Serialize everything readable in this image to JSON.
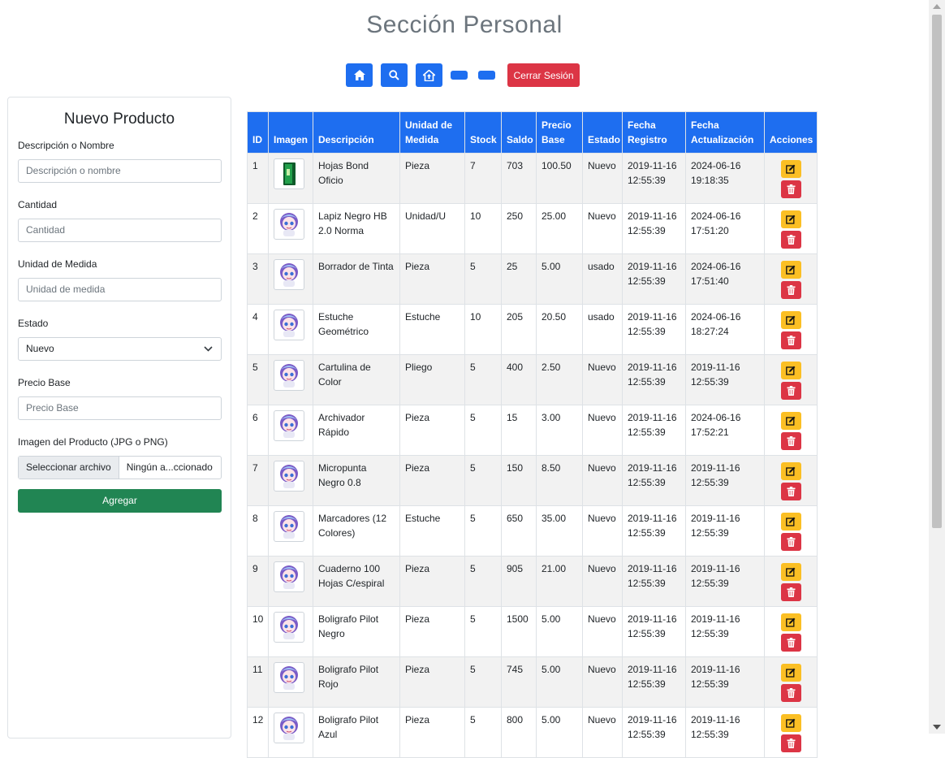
{
  "page": {
    "title": "Sección Personal"
  },
  "toolbar": {
    "home_icon": "home-icon",
    "search_icon": "search-icon",
    "house_up_icon": "house-up-icon",
    "logout_label": "Cerrar Sesión"
  },
  "form": {
    "title": "Nuevo Producto",
    "desc_label": "Descripción o Nombre",
    "desc_placeholder": "Descripción o nombre",
    "qty_label": "Cantidad",
    "qty_placeholder": "Cantidad",
    "unit_label": "Unidad de Medida",
    "unit_placeholder": "Unidad de medida",
    "state_label": "Estado",
    "state_value": "Nuevo",
    "price_label": "Precio Base",
    "price_placeholder": "Precio Base",
    "image_label": "Imagen del Producto (JPG o PNG)",
    "file_button": "Seleccionar archivo",
    "file_name": "Ningún a...ccionado",
    "submit_label": "Agregar"
  },
  "table": {
    "headers": [
      "ID",
      "Imagen",
      "Descripción",
      "Unidad de Medida",
      "Stock",
      "Saldo",
      "Precio Base",
      "Estado",
      "Fecha Registro",
      "Fecha Actualización",
      "Acciones"
    ],
    "rows": [
      {
        "id": "1",
        "thumb": "green-box",
        "desc": "Hojas Bond Oficio",
        "unit": "Pieza",
        "stock": "7",
        "saldo": "703",
        "price": "100.50",
        "state": "Nuevo",
        "reg": "2019-11-16 12:55:39",
        "upd": "2024-06-16 19:18:35"
      },
      {
        "id": "2",
        "thumb": "avatar",
        "desc": "Lapiz Negro HB 2.0 Norma",
        "unit": "Unidad/U",
        "stock": "10",
        "saldo": "250",
        "price": "25.00",
        "state": "Nuevo",
        "reg": "2019-11-16 12:55:39",
        "upd": "2024-06-16 17:51:20"
      },
      {
        "id": "3",
        "thumb": "avatar",
        "desc": "Borrador de Tinta",
        "unit": "Pieza",
        "stock": "5",
        "saldo": "25",
        "price": "5.00",
        "state": "usado",
        "reg": "2019-11-16 12:55:39",
        "upd": "2024-06-16 17:51:40"
      },
      {
        "id": "4",
        "thumb": "avatar",
        "desc": "Estuche Geométrico",
        "unit": "Estuche",
        "stock": "10",
        "saldo": "205",
        "price": "20.50",
        "state": "usado",
        "reg": "2019-11-16 12:55:39",
        "upd": "2024-06-16 18:27:24"
      },
      {
        "id": "5",
        "thumb": "avatar",
        "desc": "Cartulina de Color",
        "unit": "Pliego",
        "stock": "5",
        "saldo": "400",
        "price": "2.50",
        "state": "Nuevo",
        "reg": "2019-11-16 12:55:39",
        "upd": "2019-11-16 12:55:39"
      },
      {
        "id": "6",
        "thumb": "avatar",
        "desc": "Archivador Rápido",
        "unit": "Pieza",
        "stock": "5",
        "saldo": "15",
        "price": "3.00",
        "state": "Nuevo",
        "reg": "2019-11-16 12:55:39",
        "upd": "2024-06-16 17:52:21"
      },
      {
        "id": "7",
        "thumb": "avatar",
        "desc": "Micropunta Negro 0.8",
        "unit": "Pieza",
        "stock": "5",
        "saldo": "150",
        "price": "8.50",
        "state": "Nuevo",
        "reg": "2019-11-16 12:55:39",
        "upd": "2019-11-16 12:55:39"
      },
      {
        "id": "8",
        "thumb": "avatar",
        "desc": "Marcadores (12 Colores)",
        "unit": "Estuche",
        "stock": "5",
        "saldo": "650",
        "price": "35.00",
        "state": "Nuevo",
        "reg": "2019-11-16 12:55:39",
        "upd": "2019-11-16 12:55:39"
      },
      {
        "id": "9",
        "thumb": "avatar",
        "desc": "Cuaderno 100 Hojas C/espiral",
        "unit": "Pieza",
        "stock": "5",
        "saldo": "905",
        "price": "21.00",
        "state": "Nuevo",
        "reg": "2019-11-16 12:55:39",
        "upd": "2019-11-16 12:55:39"
      },
      {
        "id": "10",
        "thumb": "avatar",
        "desc": "Boligrafo Pilot Negro",
        "unit": "Pieza",
        "stock": "5",
        "saldo": "1500",
        "price": "5.00",
        "state": "Nuevo",
        "reg": "2019-11-16 12:55:39",
        "upd": "2019-11-16 12:55:39"
      },
      {
        "id": "11",
        "thumb": "avatar",
        "desc": "Boligrafo Pilot Rojo",
        "unit": "Pieza",
        "stock": "5",
        "saldo": "745",
        "price": "5.00",
        "state": "Nuevo",
        "reg": "2019-11-16 12:55:39",
        "upd": "2019-11-16 12:55:39"
      },
      {
        "id": "12",
        "thumb": "avatar",
        "desc": "Boligrafo Pilot Azul",
        "unit": "Pieza",
        "stock": "5",
        "saldo": "800",
        "price": "5.00",
        "state": "Nuevo",
        "reg": "2019-11-16 12:55:39",
        "upd": "2019-11-16 12:55:39"
      }
    ]
  },
  "colors": {
    "primary": "#1e6ef0",
    "danger": "#dc3545",
    "warning": "#fbbf24",
    "success": "#218553"
  }
}
